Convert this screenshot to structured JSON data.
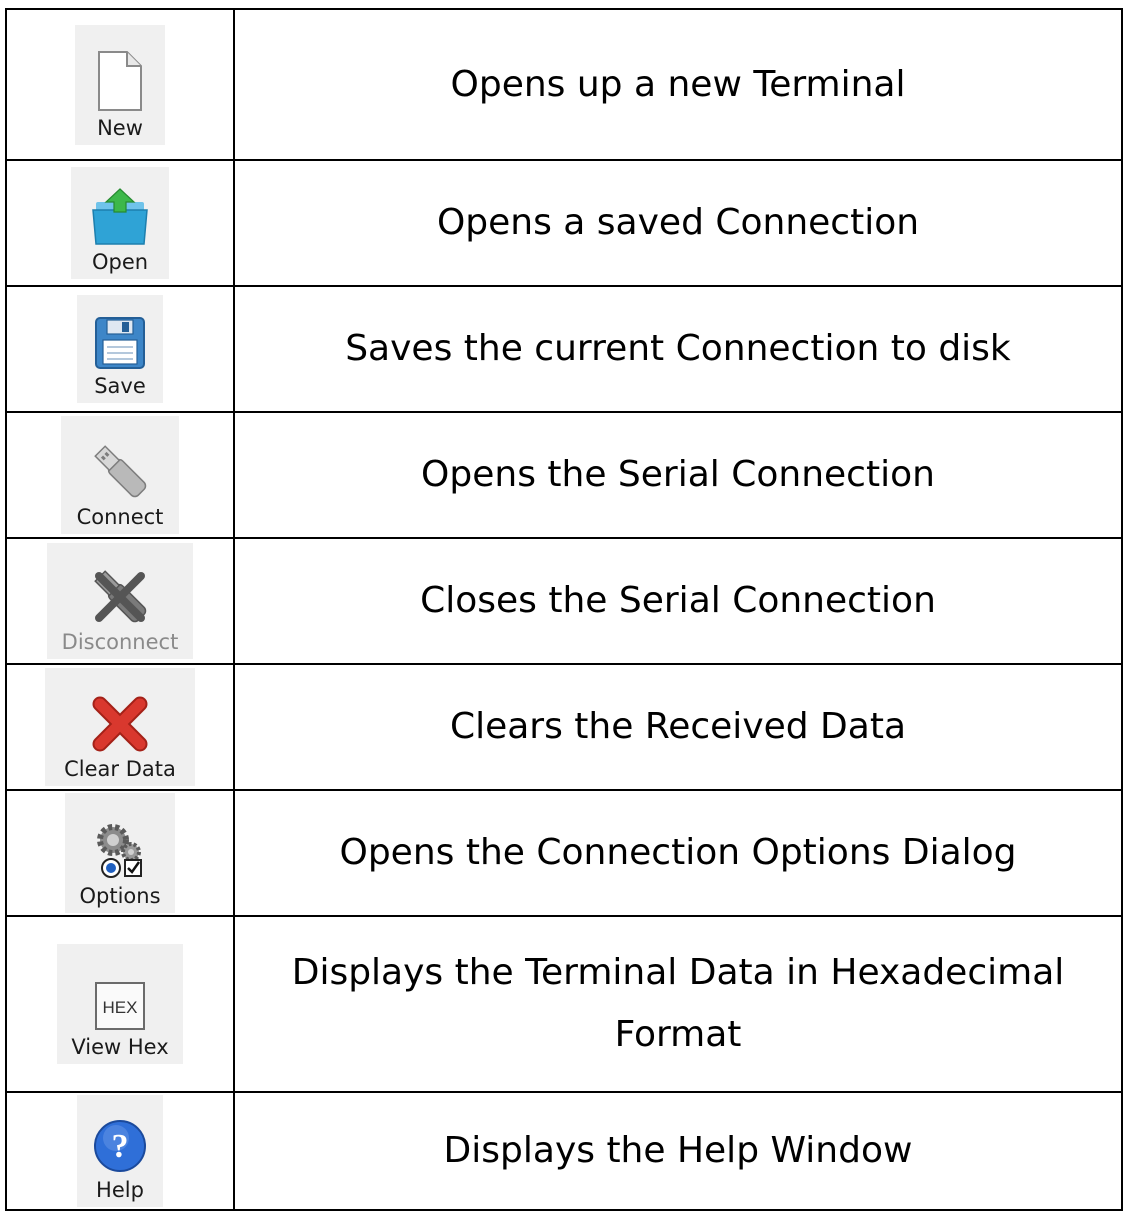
{
  "rows": [
    {
      "icon": "new-document-icon",
      "button_label": "New",
      "description": "Opens up a new Terminal"
    },
    {
      "icon": "open-folder-icon",
      "button_label": "Open",
      "description": "Opens a saved Connection"
    },
    {
      "icon": "floppy-disk-icon",
      "button_label": "Save",
      "description": "Saves the current Connection to disk"
    },
    {
      "icon": "usb-plug-icon",
      "button_label": "Connect",
      "description": "Opens the Serial Connection"
    },
    {
      "icon": "usb-plug-crossed-icon",
      "button_label": "Disconnect",
      "description": "Closes the Serial Connection"
    },
    {
      "icon": "red-x-icon",
      "button_label": "Clear Data",
      "description": "Clears the Received Data"
    },
    {
      "icon": "gears-options-icon",
      "button_label": "Options",
      "description": "Opens the Connection Options Dialog"
    },
    {
      "icon": "hex-box-icon",
      "button_label": "View Hex",
      "description_line1": "Displays the Terminal Data in Hexadecimal",
      "description_line2": "Format"
    },
    {
      "icon": "question-mark-icon",
      "button_label": "Help",
      "description": "Displays the Help Window"
    }
  ],
  "icon_text": {
    "hex": "HEX",
    "help": "?"
  },
  "colors": {
    "folder_blue": "#2fa3d6",
    "arrow_green": "#3db84a",
    "disk_blue": "#3d86c8",
    "x_red": "#d9382e",
    "help_blue": "#2f6fd8",
    "toolbar_bg": "#f0f0f0"
  }
}
